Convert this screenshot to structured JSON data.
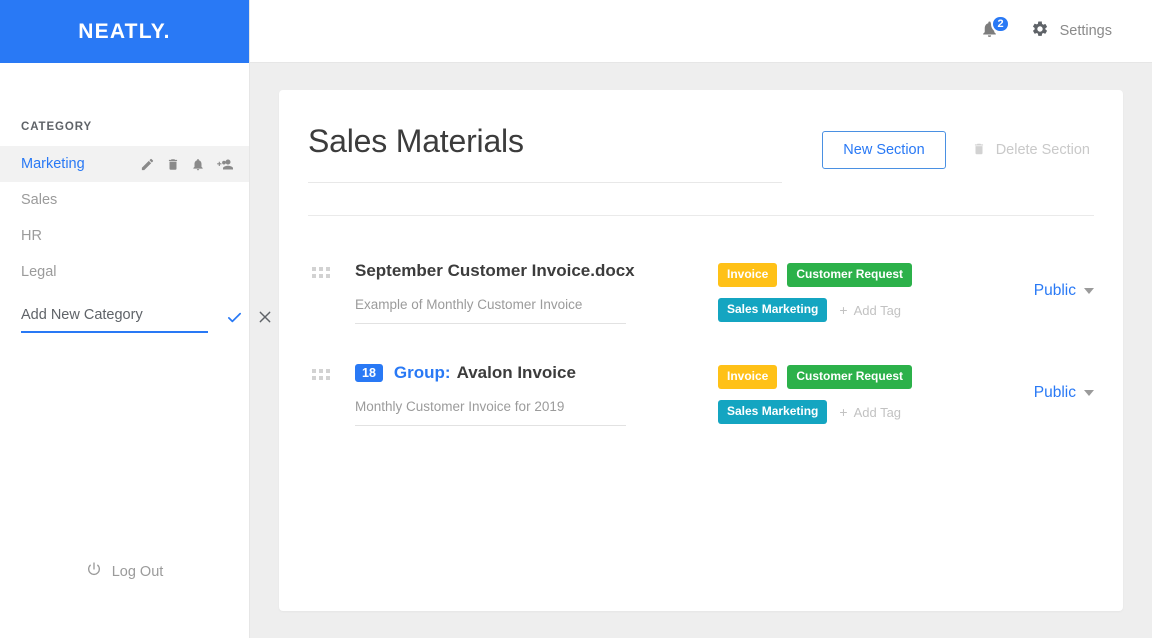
{
  "brand": {
    "name": "NEATLY."
  },
  "topbar": {
    "notifications": {
      "icon": "bell-icon",
      "count": "2"
    },
    "settings": {
      "icon": "gear-icon",
      "label": "Settings"
    }
  },
  "sidebar": {
    "heading": "CATEGORY",
    "items": [
      {
        "label": "Marketing",
        "active": true,
        "actions": [
          "pencil-icon",
          "trash-icon",
          "bell-icon",
          "add-person-icon"
        ]
      },
      {
        "label": "Sales",
        "active": false,
        "actions": []
      },
      {
        "label": "HR",
        "active": false,
        "actions": []
      },
      {
        "label": "Legal",
        "active": false,
        "actions": []
      }
    ],
    "add_category": {
      "value": "",
      "placeholder": "Add New Category",
      "confirm_icon": "check-icon",
      "cancel_icon": "close-icon"
    },
    "logout": {
      "icon": "power-icon",
      "label": "Log Out"
    }
  },
  "main": {
    "title": "Sales Materials",
    "new_section_label": "New Section",
    "delete_section_label": "Delete Section",
    "delete_section_icon": "trash-icon",
    "rows": [
      {
        "drag_icon": "drag-handle-icon",
        "badge": "",
        "title_prefix": "",
        "title": "September Customer Invoice.docx",
        "description": "Example of Monthly Customer Invoice",
        "tags_row1": [
          {
            "label": "Invoice",
            "color": "#ffc117"
          },
          {
            "label": "Customer Request",
            "color": "#2cb14a"
          }
        ],
        "tags_row2": [
          {
            "label": "Sales Marketing",
            "color": "#14a5c1"
          }
        ],
        "add_tag_label": "Add Tag",
        "visibility": "Public"
      },
      {
        "drag_icon": "drag-handle-icon",
        "badge": "18",
        "title_prefix": "Group:",
        "title": "Avalon Invoice",
        "description": "Monthly Customer Invoice for 2019",
        "tags_row1": [
          {
            "label": "Invoice",
            "color": "#ffc117"
          },
          {
            "label": "Customer Request",
            "color": "#2cb14a"
          }
        ],
        "tags_row2": [
          {
            "label": "Sales Marketing",
            "color": "#14a5c1"
          }
        ],
        "add_tag_label": "Add Tag",
        "visibility": "Public"
      }
    ]
  },
  "colors": {
    "brand_blue": "#2979f5",
    "page_bg": "#eeeeee",
    "tag_yellow": "#ffc117",
    "tag_green": "#2cb14a",
    "tag_teal": "#14a5c1"
  }
}
